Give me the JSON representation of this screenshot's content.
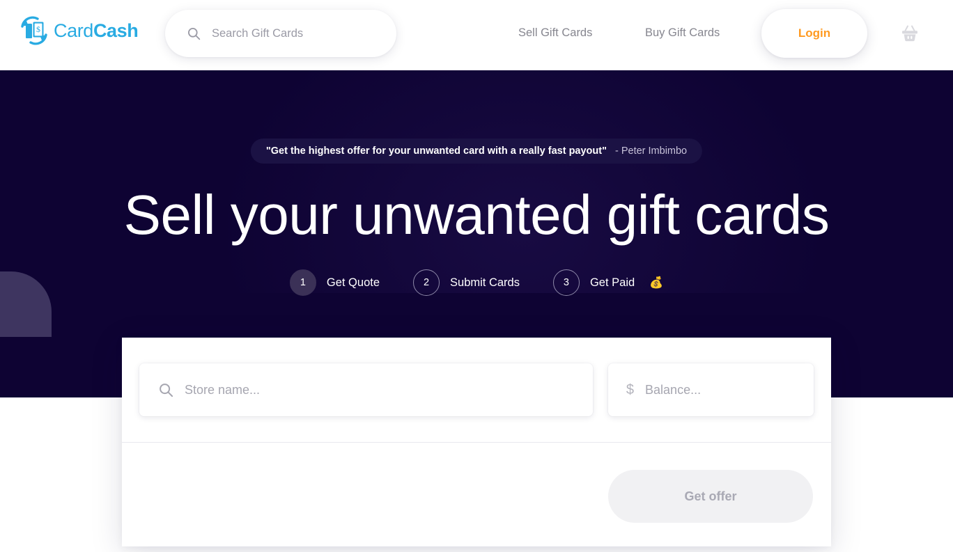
{
  "header": {
    "logo": {
      "brand_light": "Card",
      "brand_bold": "Cash",
      "icon": "cardcash-logo-icon",
      "color": "#29ABE2"
    },
    "search": {
      "placeholder": "Search Gift Cards",
      "value": "",
      "icon": "search-icon"
    },
    "nav": [
      {
        "label": "Sell Gift Cards",
        "name": "nav-sell-gift-cards"
      },
      {
        "label": "Buy Gift Cards",
        "name": "nav-buy-gift-cards"
      }
    ],
    "login": {
      "label": "Login",
      "color": "#FF9A21"
    },
    "cart": {
      "icon": "shopping-basket-icon"
    }
  },
  "hero": {
    "background_color": "#0E0333",
    "quote": {
      "text": "\"Get the highest offer for your unwanted card with a really fast payout\"",
      "author": "- Peter Imbimbo"
    },
    "headline": "Sell your unwanted gift cards",
    "steps": [
      {
        "number": "1",
        "label": "Get Quote",
        "active": true,
        "emoji": ""
      },
      {
        "number": "2",
        "label": "Submit Cards",
        "active": false,
        "emoji": ""
      },
      {
        "number": "3",
        "label": "Get Paid",
        "active": false,
        "emoji": "💰"
      }
    ]
  },
  "form": {
    "store": {
      "placeholder": "Store name...",
      "value": "",
      "icon": "search-icon"
    },
    "balance": {
      "placeholder": "Balance...",
      "value": "",
      "icon": "dollar-sign-icon",
      "symbol": "$"
    },
    "submit": {
      "label": "Get offer",
      "disabled": true
    }
  }
}
